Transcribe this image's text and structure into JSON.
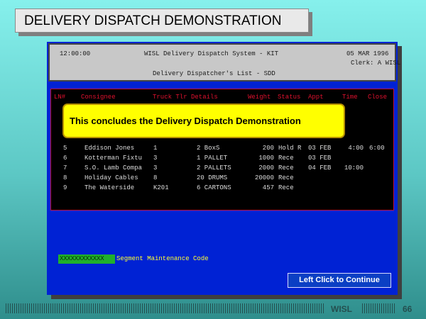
{
  "slide": {
    "title": "DELIVERY DISPATCH DEMONSTRATION"
  },
  "header": {
    "time": "12:00:00",
    "system": "WISL Delivery Dispatch System - KIT",
    "date": "05 MAR 1996",
    "clerk": "Clerk: A WISL",
    "screen_title": "Delivery Dispatcher's List - SDD"
  },
  "list": {
    "columns": [
      "LN#",
      "Consignee",
      "Truck Tlr Details",
      "Weight",
      "Status",
      "Appt",
      "Time",
      "Close"
    ],
    "rows": [
      {
        "ln": "5",
        "consignee": "Eddison Jones",
        "truck": "1",
        "details": "2 BoxS",
        "weight": "200",
        "status": "Hold R",
        "appt": "03 FEB",
        "time": "4:00",
        "close": "6:00"
      },
      {
        "ln": "6",
        "consignee": "Kotterman Fixtu",
        "truck": "3",
        "details": "1 PALLET",
        "weight": "1000",
        "status": "Rece",
        "appt": "03 FEB",
        "time": "",
        "close": ""
      },
      {
        "ln": "7",
        "consignee": "S.O. Lamb Compa",
        "truck": "3",
        "details": "2 PALLETS",
        "weight": "2000",
        "status": "Rece",
        "appt": "04 FEB",
        "time": "10:00",
        "close": ""
      },
      {
        "ln": "8",
        "consignee": "Holiday Cables",
        "truck": "8",
        "details": "20 DRUMS",
        "weight": "20000",
        "status": "Rece",
        "appt": "",
        "time": "",
        "close": ""
      },
      {
        "ln": "9",
        "consignee": "The Waterside",
        "truck": "K201",
        "details": "6 CARTONS",
        "weight": "457",
        "status": "Rece",
        "appt": "",
        "time": "",
        "close": ""
      }
    ]
  },
  "popup": {
    "message": "This concludes the Delivery Dispatch Demonstration"
  },
  "segment": {
    "code_value": "XXXXXXXXXXXX",
    "label": "Segment Maintenance Code"
  },
  "continue_button": {
    "label": "Left Click to Continue"
  },
  "footer": {
    "brand": "WISL",
    "page": "66"
  },
  "colors": {
    "screen_bg": "#0022d4",
    "popup_bg": "#ffff00",
    "column_header": "#e0112e",
    "code_field": "#20b02c"
  }
}
